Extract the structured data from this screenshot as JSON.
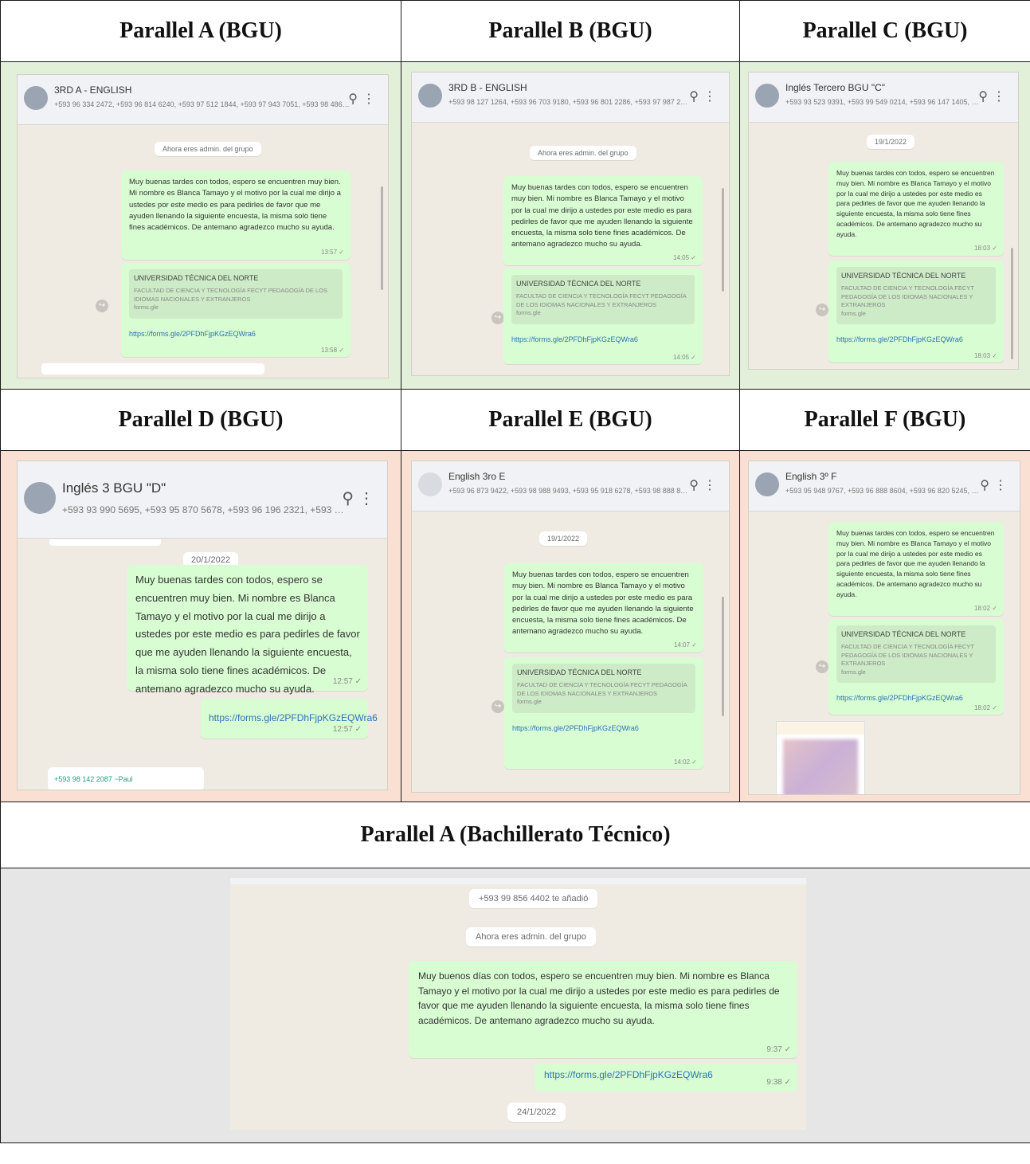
{
  "headers": {
    "a": "Parallel A (BGU)",
    "b": "Parallel B (BGU)",
    "c": "Parallel C (BGU)",
    "d": "Parallel D (BGU)",
    "e": "Parallel E (BGU)",
    "f": "Parallel F (BGU)",
    "tech": "Parallel A (Bachillerato Técnico)"
  },
  "colors": {
    "green_band": "#e2efd9",
    "pink_band": "#f9e0d2",
    "gray_band": "#e6e6e6",
    "bubble": "#d9fdd3",
    "chat_bg": "#efeae2"
  },
  "icons": {
    "search": "search-icon",
    "menu": "kebab-menu-icon",
    "forward": "forward-icon",
    "read": "double-check-icon"
  },
  "shots": {
    "a": {
      "title": "3RD A - ENGLISH",
      "members": "+593 96 334 2472, +593 96 814 6240, +593 97 512 1844, +593 97 943 7051, +593 98 486 5652, +593 98 501 4...",
      "system": "Ahora eres admin. del grupo",
      "message": "Muy buenas tardes con todos, espero se encuentren muy bien. Mi nombre es Blanca Tamayo y el motivo por la cual me dirijo a ustedes por este medio es para pedirles de favor que me ayuden llenando la siguiente encuesta, la misma solo tiene fines académicos. De antemano agradezco mucho su ayuda.",
      "msg_time": "13:57 ✓",
      "card_title": "UNIVERSIDAD TÉCNICA DEL NORTE",
      "card_sub": "FACULTAD DE CIENCIA Y TECNOLOGÍA FECYT PEDAGOGÍA DE LOS IDIOMAS NACIONALES Y EXTRANJEROS",
      "card_small": "forms.gle",
      "link": "https://forms.gle/2PFDhFjpKGzEQWra6",
      "link_time": "13:58 ✓"
    },
    "b": {
      "title": "3RD B - ENGLISH",
      "members": "+593 98 127 1264, +593 96 703 9180, +593 96 801 2286, +593 97 987 2596, +593 97 099 8106, +593 97 943 5...",
      "system": "Ahora eres admin. del grupo",
      "message": "Muy buenas tardes con todos, espero se encuentren muy bien. Mi nombre es Blanca Tamayo y el motivo por la cual me dirijo a ustedes por este medio es para pedirles de favor que me ayuden llenando la siguiente encuesta, la misma solo tiene fines académicos. De antemano agradezco mucho su ayuda.",
      "msg_time": "14:05 ✓",
      "card_title": "UNIVERSIDAD TÉCNICA DEL NORTE",
      "card_sub": "FACULTAD DE CIENCIA Y TECNOLOGÍA FECYT PEDAGOGÍA DE LOS IDIOMAS NACIONALES Y EXTRANJEROS",
      "card_small": "forms.gle",
      "link": "https://forms.gle/2PFDhFjpKGzEQWra6",
      "link_time": "14:05 ✓"
    },
    "c": {
      "title": "Inglés Tercero BGU \"C\"",
      "members": "+593 93 523 9391, +593 99 549 0214, +593 96 147 1405, +593 98 709 3913, +593 96 173 4885, +593 96 336 2...",
      "system": "19/1/2022",
      "message": "Muy buenas tardes con todos, espero se encuentren muy bien. Mi nombre es Blanca Tamayo y el motivo por la cual me dirijo a ustedes por este medio es para pedirles de favor que me ayuden llenando la siguiente encuesta, la misma solo tiene fines académicos. De antemano agradezco mucho su ayuda.",
      "msg_time": "18:03 ✓",
      "card_title": "UNIVERSIDAD TÉCNICA DEL NORTE",
      "card_sub": "FACULTAD DE CIENCIA Y TECNOLOGÍA FECYT PEDAGOGÍA DE LOS IDIOMAS NACIONALES Y EXTRANJEROS",
      "card_small": "forms.gle",
      "link": "https://forms.gle/2PFDhFjpKGzEQWra6",
      "link_time": "18:03 ✓"
    },
    "d": {
      "title": "Inglés 3 BGU \"D\"",
      "members": "+593 93 990 5695, +593 95 870 5678, +593 96 196 2321, +593 96 219 1279, +593 96 361 3479, +593 96 742 0...",
      "system": "20/1/2022",
      "message": "Muy buenas tardes con todos, espero se encuentren muy bien. Mi nombre es Blanca Tamayo y el motivo por la cual me dirijo a ustedes por este medio es para pedirles de favor que me ayuden llenando la siguiente encuesta, la misma solo tiene fines académicos. De antemano agradezco mucho su ayuda.",
      "msg_time": "12:57 ✓",
      "link": "https://forms.gle/2PFDhFjpKGzEQWra6",
      "link_time": "12:57 ✓",
      "preview": "+593 98 142 2087  ~Paul"
    },
    "e": {
      "title": "English 3ro E",
      "members": "+593 96 873 9422, +593 98 988 9493, +593 95 918 6278, +593 98 888 8846, +593 96 932 3434, +593 96 2307...",
      "system": "19/1/2022",
      "message": "Muy buenas tardes con todos, espero se encuentren muy bien. Mi nombre es Blanca Tamayo y el motivo por la cual me dirijo a ustedes por este medio es para pedirles de favor que me ayuden llenando la siguiente encuesta, la misma solo tiene fines académicos. De antemano agradezco mucho su ayuda.",
      "msg_time": "14:07 ✓",
      "card_title": "UNIVERSIDAD TÉCNICA DEL NORTE",
      "card_sub": "FACULTAD DE CIENCIA Y TECNOLOGÍA FECYT PEDAGOGÍA DE LOS IDIOMAS NACIONALES Y EXTRANJEROS",
      "card_small": "forms.gle",
      "link": "https://forms.gle/2PFDhFjpKGzEQWra6",
      "link_time": "14:02 ✓"
    },
    "f": {
      "title": "English 3º F",
      "members": "+593 95 948 9767, +593 96 888 8604, +593 96 820 5245, +593 96 391 3163, +593 96 767 8845, +593 98 881 5...",
      "message": "Muy buenas tardes con todos, espero se encuentren muy bien. Mi nombre es Blanca Tamayo y el motivo por la cual me dirijo a ustedes por este medio es para pedirles de favor que me ayuden llenando la siguiente encuesta, la misma solo tiene fines académicos. De antemano agradezco mucho su ayuda.",
      "msg_time": "18:02 ✓",
      "card_title": "UNIVERSIDAD TÉCNICA DEL NORTE",
      "card_sub": "FACULTAD DE CIENCIA Y TECNOLOGÍA FECYT PEDAGOGÍA DE LOS IDIOMAS NACIONALES Y EXTRANJEROS",
      "card_small": "forms.gle",
      "link": "https://forms.gle/2PFDhFjpKGzEQWra6",
      "link_time": "18:02 ✓"
    },
    "tech": {
      "added": "+593 99 856 4402 te añadió",
      "system": "Ahora eres admin. del grupo",
      "message": "Muy buenos días con todos, espero se encuentren muy bien. Mi nombre es Blanca Tamayo y el motivo por la cual me dirijo a ustedes por este medio es para pedirles de favor que me ayuden llenando la siguiente encuesta, la misma solo tiene fines académicos. De antemano agradezco mucho su ayuda.",
      "msg_time": "9:37 ✓",
      "link": "https://forms.gle/2PFDhFjpKGzEQWra6",
      "link_time": "9:38 ✓",
      "date": "24/1/2022"
    }
  }
}
